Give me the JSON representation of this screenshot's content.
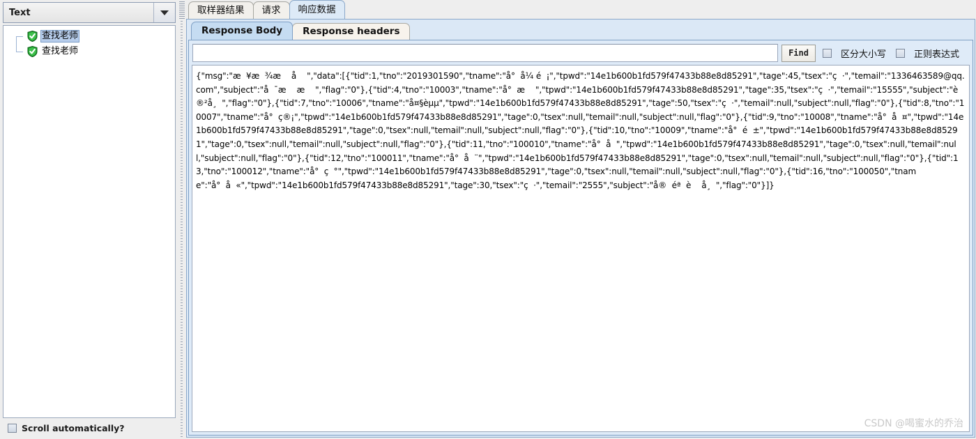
{
  "left": {
    "combo": {
      "selected": "Text",
      "arrow_icon": "chevron-down-icon"
    },
    "tree": {
      "nodes": [
        {
          "label": "查找老师",
          "icon": "green-shield-check-icon",
          "selected": true
        },
        {
          "label": "查找老师",
          "icon": "green-shield-check-icon",
          "selected": false
        }
      ]
    },
    "scroll_automatically": {
      "label": "Scroll automatically?",
      "checked": false
    }
  },
  "right": {
    "outer_tabs": [
      {
        "label": "取样器结果",
        "active": false
      },
      {
        "label": "请求",
        "active": false
      },
      {
        "label": "响应数据",
        "active": true
      }
    ],
    "inner_tabs": [
      {
        "label": "Response Body",
        "active": true
      },
      {
        "label": "Response headers",
        "active": false
      }
    ],
    "find_bar": {
      "input_value": "",
      "input_placeholder": "",
      "find_button": "Find",
      "case_sensitive": {
        "label": "区分大小写",
        "checked": false
      },
      "regex": {
        "label": "正则表达式",
        "checked": false
      }
    },
    "response_body": "{\"msg\":\"æ ¥æ ¾æ  å  \",\"data\":[{\"tid\":1,\"tno\":\"2019301590\",\"tname\":\"å° å¼ é ¡\",\"tpwd\":\"14e1b600b1fd579f47433b88e8d85291\",\"tage\":45,\"tsex\":\"ç ·\",\"temail\":\"1336463589@qq.com\",\"subject\":\"å ¯æ  æ  \",\"flag\":\"0\"},{\"tid\":4,\"tno\":\"10003\",\"tname\":\"å° æ  \",\"tpwd\":\"14e1b600b1fd579f47433b88e8d85291\",\"tage\":35,\"tsex\":\"ç ·\",\"temail\":\"15555\",\"subject\":\"è®²å¸ \",\"flag\":\"0\"},{\"tid\":7,\"tno\":\"10006\",\"tname\":\"å¤§èµµ\",\"tpwd\":\"14e1b600b1fd579f47433b88e8d85291\",\"tage\":50,\"tsex\":\"ç ·\",\"temail\":null,\"subject\":null,\"flag\":\"0\"},{\"tid\":8,\"tno\":\"10007\",\"tname\":\"å° ç®¡\",\"tpwd\":\"14e1b600b1fd579f47433b88e8d85291\",\"tage\":0,\"tsex\":null,\"temail\":null,\"subject\":null,\"flag\":\"0\"},{\"tid\":9,\"tno\":\"10008\",\"tname\":\"å° å ¤\",\"tpwd\":\"14e1b600b1fd579f47433b88e8d85291\",\"tage\":0,\"tsex\":null,\"temail\":null,\"subject\":null,\"flag\":\"0\"},{\"tid\":10,\"tno\":\"10009\",\"tname\":\"å° é ±\",\"tpwd\":\"14e1b600b1fd579f47433b88e8d85291\",\"tage\":0,\"tsex\":null,\"temail\":null,\"subject\":null,\"flag\":\"0\"},{\"tid\":11,\"tno\":\"100010\",\"tname\":\"å° å­ \",\"tpwd\":\"14e1b600b1fd579f47433b88e8d85291\",\"tage\":0,\"tsex\":null,\"temail\":null,\"subject\":null,\"flag\":\"0\"},{\"tid\":12,\"tno\":\"100011\",\"tname\":\"å° å ¨\",\"tpwd\":\"14e1b600b1fd579f47433b88e8d85291\",\"tage\":0,\"tsex\":null,\"temail\":null,\"subject\":null,\"flag\":\"0\"},{\"tid\":13,\"tno\":\"100012\",\"tname\":\"å° ç °\",\"tpwd\":\"14e1b600b1fd579f47433b88e8d85291\",\"tage\":0,\"tsex\":null,\"temail\":null,\"subject\":null,\"flag\":\"0\"},{\"tid\":16,\"tno\":\"100050\",\"tname\":\"å° å «\",\"tpwd\":\"14e1b600b1fd579f47433b88e8d85291\",\"tage\":30,\"tsex\":\"ç ·\",\"temail\":\"2555\",\"subject\":\"å® éª è  å¸ \",\"flag\":\"0\"}]}"
  },
  "watermark": "CSDN @喝蜜水的乔治"
}
